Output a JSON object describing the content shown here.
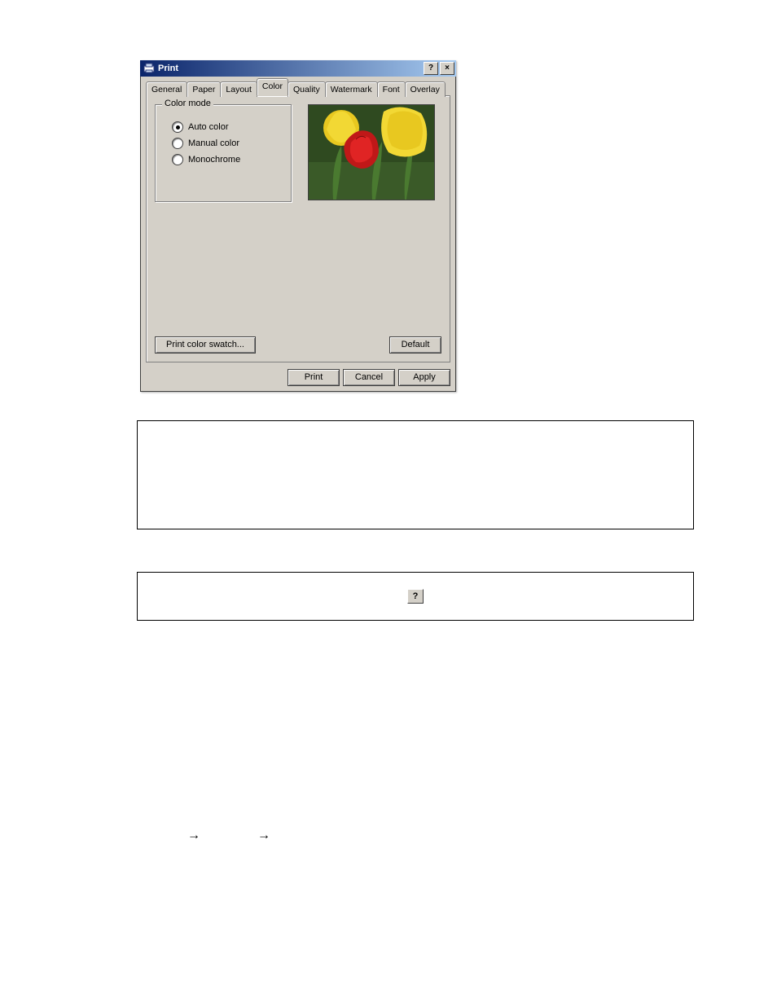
{
  "window": {
    "title": "Print",
    "help_glyph": "?",
    "close_glyph": "×"
  },
  "tabs": [
    "General",
    "Paper",
    "Layout",
    "Color",
    "Quality",
    "Watermark",
    "Font",
    "Overlay"
  ],
  "active_tab_index": 3,
  "color_mode": {
    "legend": "Color mode",
    "options": [
      "Auto color",
      "Manual color",
      "Monochrome"
    ],
    "selected_index": 0
  },
  "buttons": {
    "swatch": "Print color swatch...",
    "default": "Default",
    "print": "Print",
    "cancel": "Cancel",
    "apply": "Apply"
  },
  "help_icon_glyph": "?",
  "arrows": {
    "glyph": "→"
  }
}
